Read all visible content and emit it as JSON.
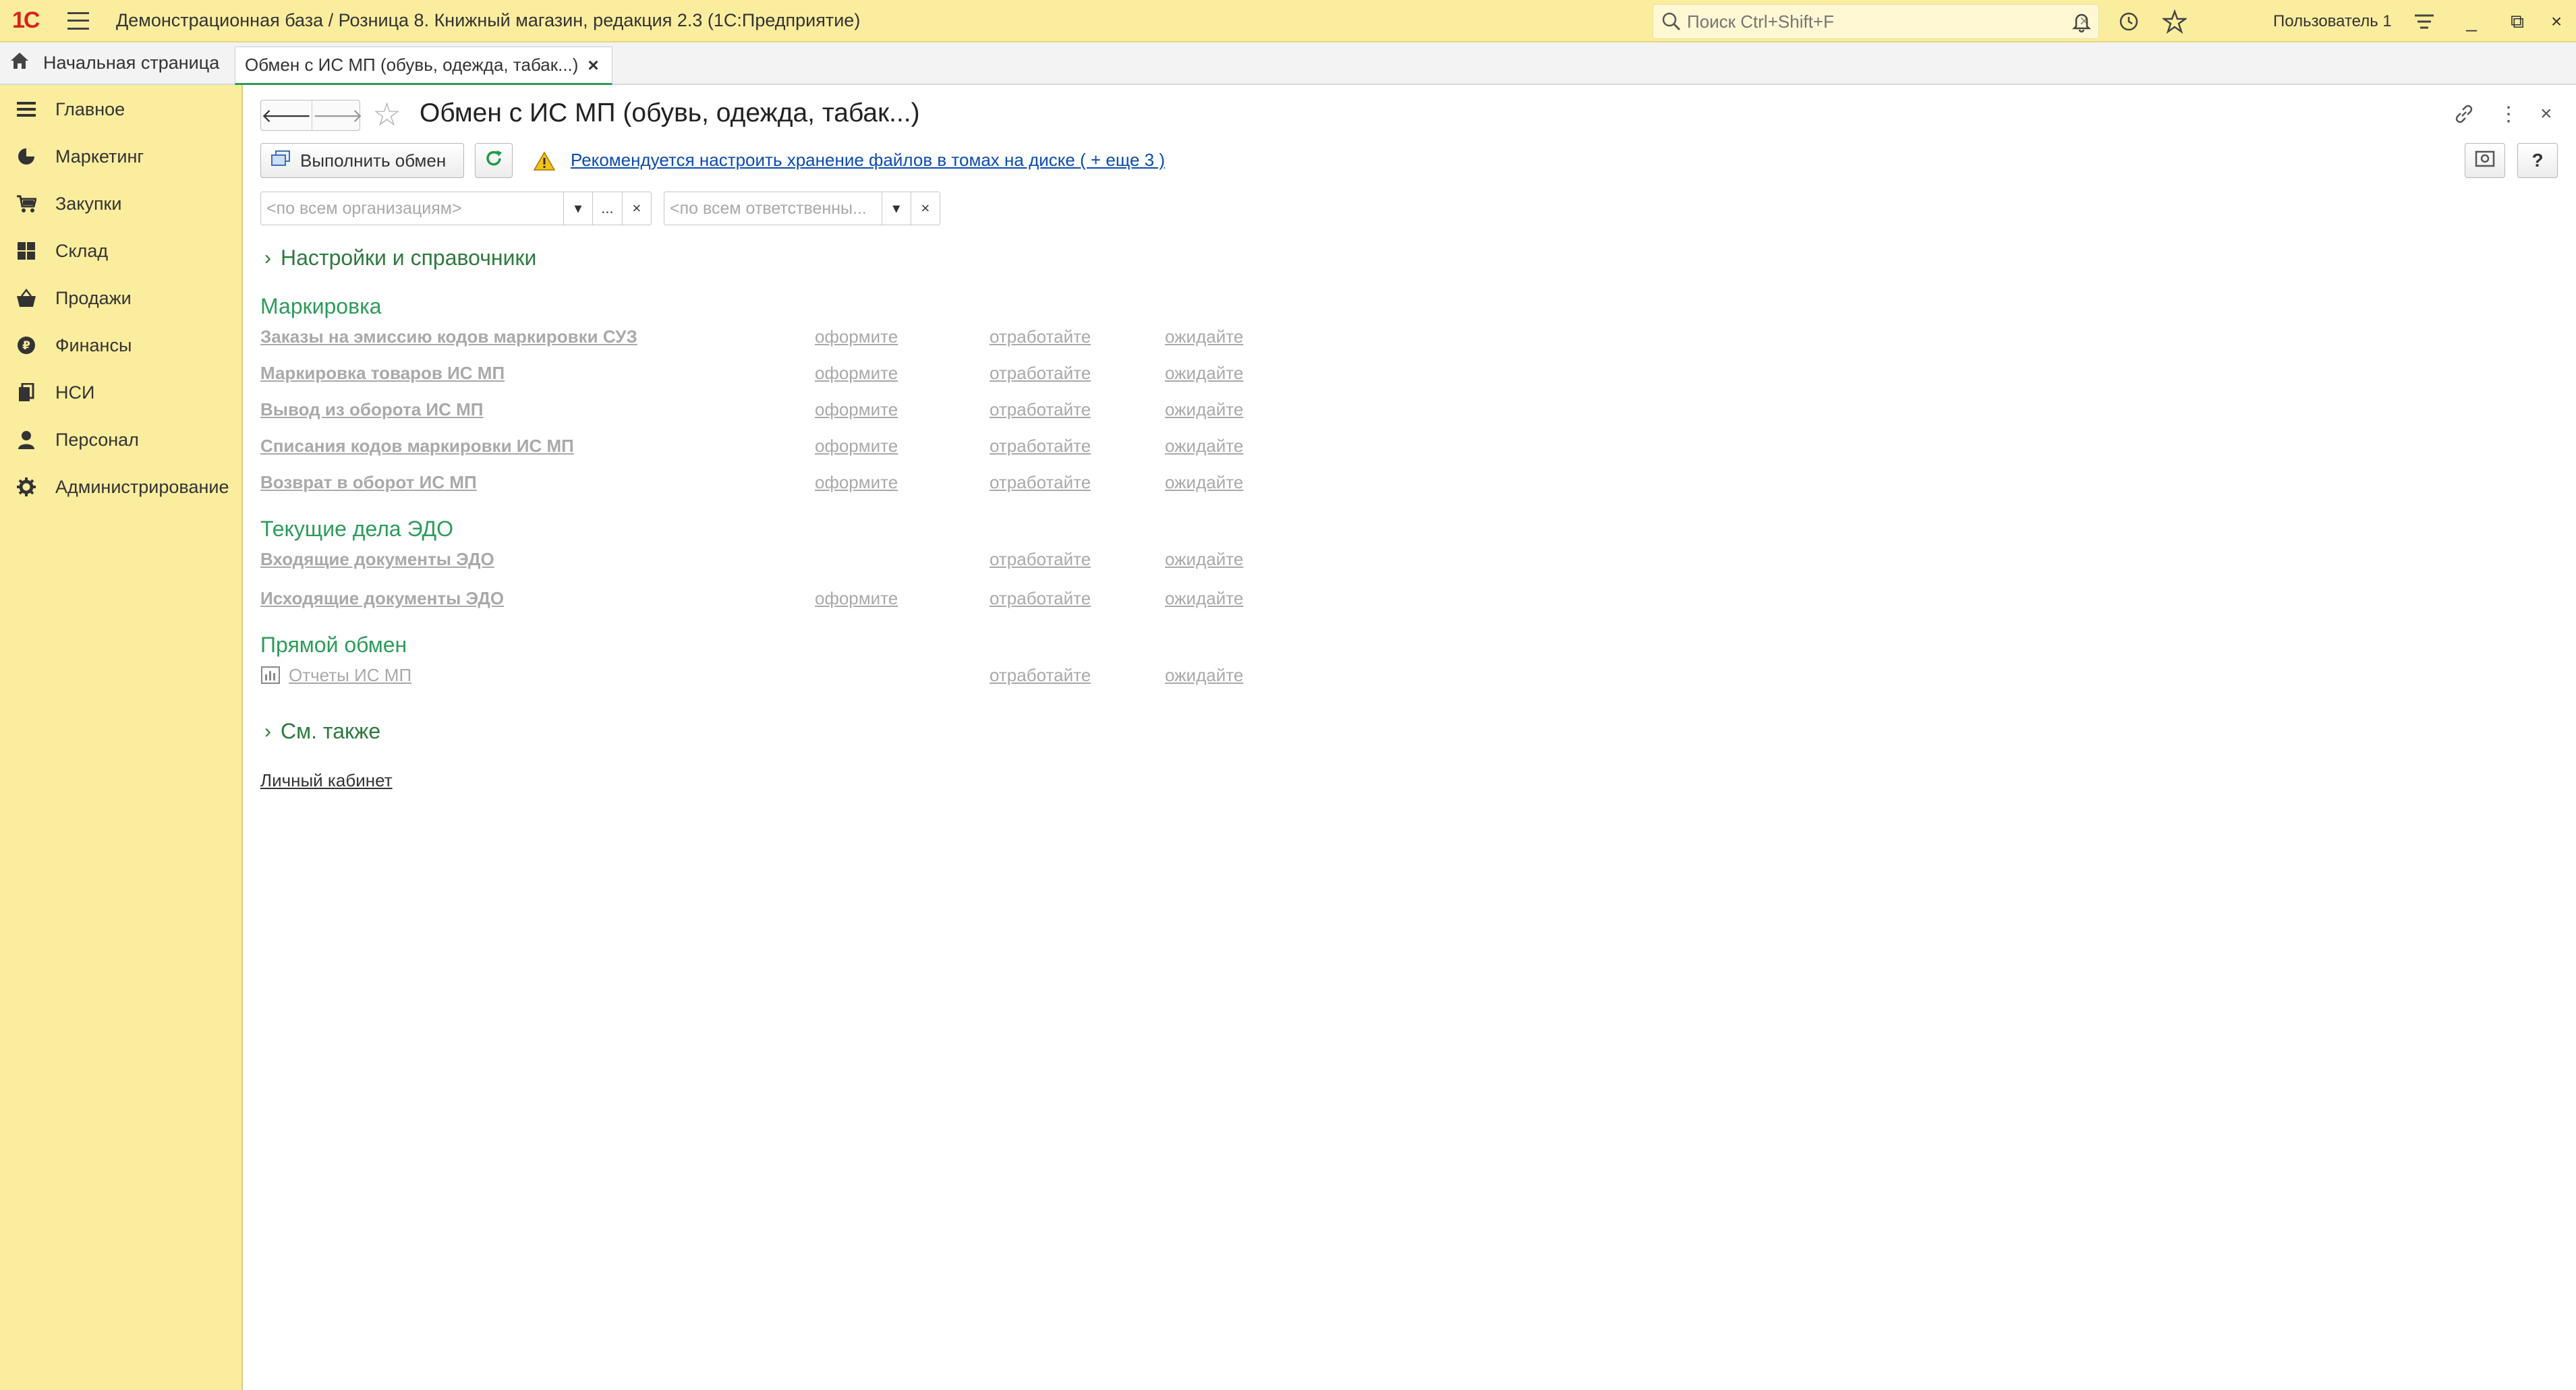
{
  "titlebar": {
    "logo": "1С",
    "app_title": "Демонстрационная база / Розница 8. Книжный магазин, редакция 2.3  (1С:Предприятие)",
    "search_placeholder": "Поиск Ctrl+Shift+F",
    "search_clear": "×",
    "user": "Пользователь 1",
    "minimize": "_",
    "restore": "⧉",
    "close": "×"
  },
  "tabs": {
    "home": "Начальная страница",
    "active": "Обмен с ИС МП (обувь, одежда, табак...)",
    "active_close": "×"
  },
  "sidebar": {
    "items": [
      {
        "label": "Главное",
        "icon": "menu-icon"
      },
      {
        "label": "Маркетинг",
        "icon": "pie-chart-icon"
      },
      {
        "label": "Закупки",
        "icon": "cart-icon"
      },
      {
        "label": "Склад",
        "icon": "warehouse-icon"
      },
      {
        "label": "Продажи",
        "icon": "basket-icon"
      },
      {
        "label": "Финансы",
        "icon": "ruble-icon"
      },
      {
        "label": "НСИ",
        "icon": "books-icon"
      },
      {
        "label": "Персонал",
        "icon": "person-icon"
      },
      {
        "label": "Администрирование",
        "icon": "gear-icon"
      }
    ]
  },
  "form": {
    "title": "Обмен с ИС МП (обувь, одежда, табак...)",
    "back": "🡐",
    "forward": "🡒",
    "star": "☆",
    "link_icon": "🔗",
    "more_icon": "⋮",
    "close_icon": "×",
    "help": "?",
    "execute_button": "Выполнить обмен",
    "warning_link": "Рекомендуется настроить хранение файлов в томах на диске ( + еще 3 )",
    "org_filter_placeholder": "<по всем организациям>",
    "resp_filter_placeholder": "<по всем ответственны...",
    "combo_dropdown": "▾",
    "combo_more": "...",
    "combo_clear": "×"
  },
  "groups": {
    "settings": "Настройки и справочники",
    "see_also": "См. также"
  },
  "sections": {
    "marking": {
      "title": "Маркировка",
      "rows": [
        {
          "label": "Заказы на эмиссию кодов маркировки СУЗ",
          "c1": "оформите",
          "c2": "отработайте",
          "c3": "ожидайте"
        },
        {
          "label": "Маркировка товаров ИС МП",
          "c1": "оформите",
          "c2": "отработайте",
          "c3": "ожидайте"
        },
        {
          "label": "Вывод из оборота ИС МП",
          "c1": "оформите",
          "c2": "отработайте",
          "c3": "ожидайте"
        },
        {
          "label": "Списания кодов маркировки ИС МП",
          "c1": "оформите",
          "c2": "отработайте",
          "c3": "ожидайте"
        },
        {
          "label": "Возврат в оборот ИС МП",
          "c1": "оформите",
          "c2": "отработайте",
          "c3": "ожидайте"
        }
      ]
    },
    "edo": {
      "title": "Текущие дела ЭДО",
      "rows": [
        {
          "label": "Входящие документы ЭДО",
          "c1": "",
          "c2": "отработайте",
          "c3": "ожидайте"
        },
        {
          "label": "Исходящие документы ЭДО",
          "c1": "оформите",
          "c2": "отработайте",
          "c3": "ожидайте"
        }
      ]
    },
    "direct": {
      "title": "Прямой обмен",
      "rows": [
        {
          "label": "Отчеты ИС МП",
          "c2": "отработайте",
          "c3": "ожидайте"
        }
      ]
    }
  },
  "cabinet_link": "Личный кабинет"
}
